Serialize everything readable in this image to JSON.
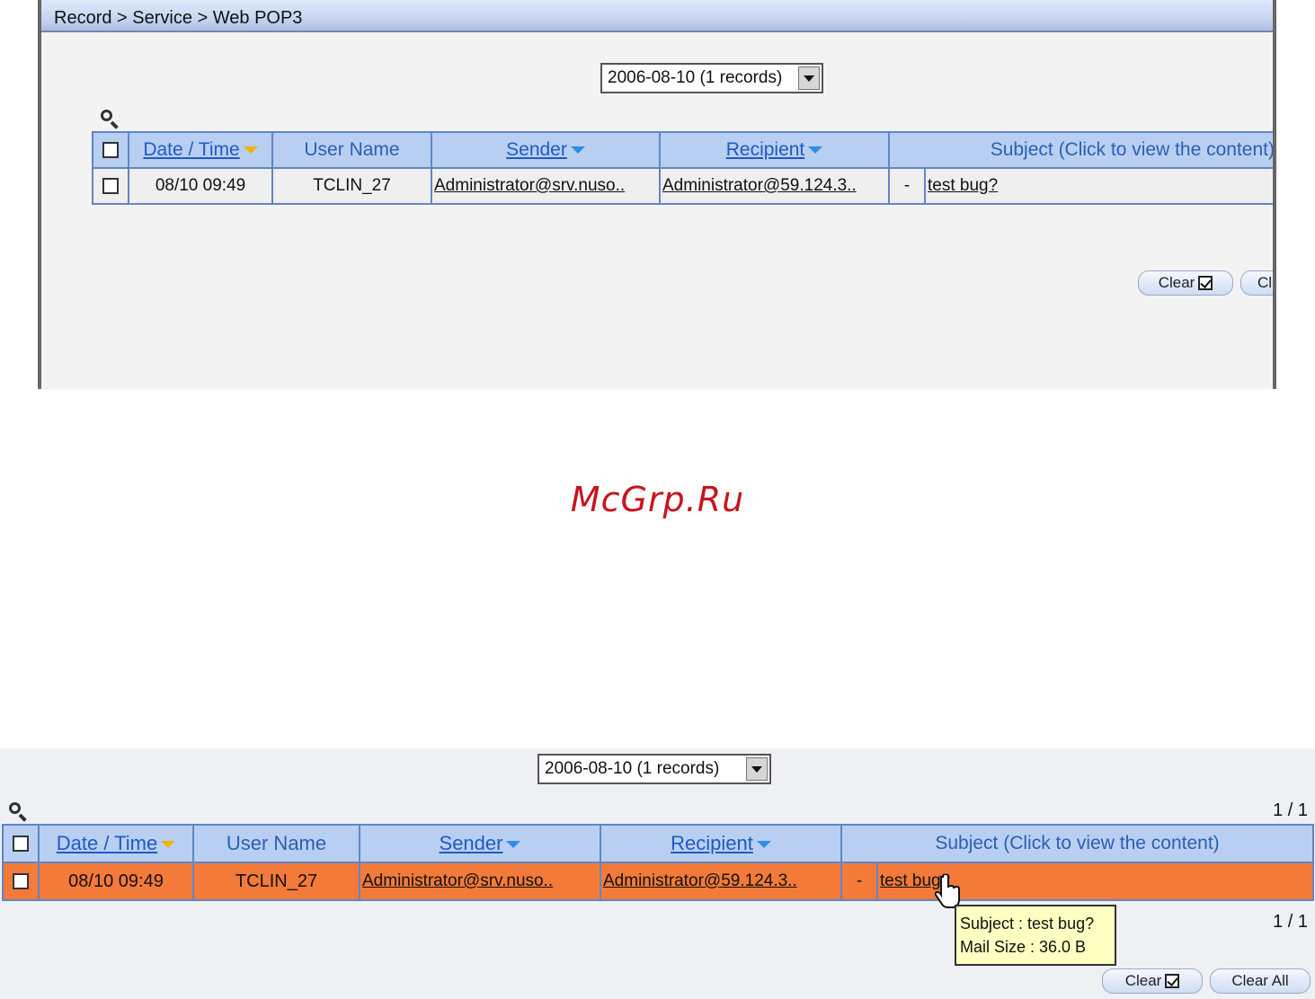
{
  "top_screenshot": {
    "breadcrumb": "Record > Service > Web POP3",
    "date_select": "2006-08-10 (1 records)",
    "columns": {
      "date_time": "Date / Time",
      "user_name": "User Name",
      "sender": "Sender",
      "recipient": "Recipient",
      "subject": "Subject (Click to view the content)"
    },
    "row": {
      "date_time": "08/10 09:49",
      "user_name": "TCLIN_27",
      "sender": "Administrator@srv.nuso..",
      "recipient": "Administrator@59.124.3..",
      "flag": "-",
      "subject": "test bug?"
    },
    "buttons": {
      "clear": "Clear",
      "clear_all_partial": "Cl"
    }
  },
  "watermark": "McGrp.Ru",
  "bottom_screenshot": {
    "date_select": "2006-08-10 (1 records)",
    "pager_top": "1 / 1",
    "pager_bottom": "1 / 1",
    "columns": {
      "date_time": "Date / Time",
      "user_name": "User Name",
      "sender": "Sender",
      "recipient": "Recipient",
      "subject": "Subject (Click to view the content)"
    },
    "row": {
      "date_time": "08/10 09:49",
      "user_name": "TCLIN_27",
      "sender": "Administrator@srv.nuso..",
      "recipient": "Administrator@59.124.3..",
      "flag": "-",
      "subject": "test bug?",
      "highlight_color": "#f47a3a"
    },
    "tooltip": {
      "subject_line": "Subject : test bug?",
      "size_line": "Mail Size : 36.0 B"
    },
    "buttons": {
      "clear": "Clear",
      "clear_all": "Clear All"
    }
  },
  "colors": {
    "header_bg": "#b9cff1",
    "header_link": "#1d5bc4",
    "grid_border": "#5f86c6",
    "sort_active": "#f0b400",
    "sort_inactive": "#2f8fe8",
    "watermark": "#c8141c"
  }
}
